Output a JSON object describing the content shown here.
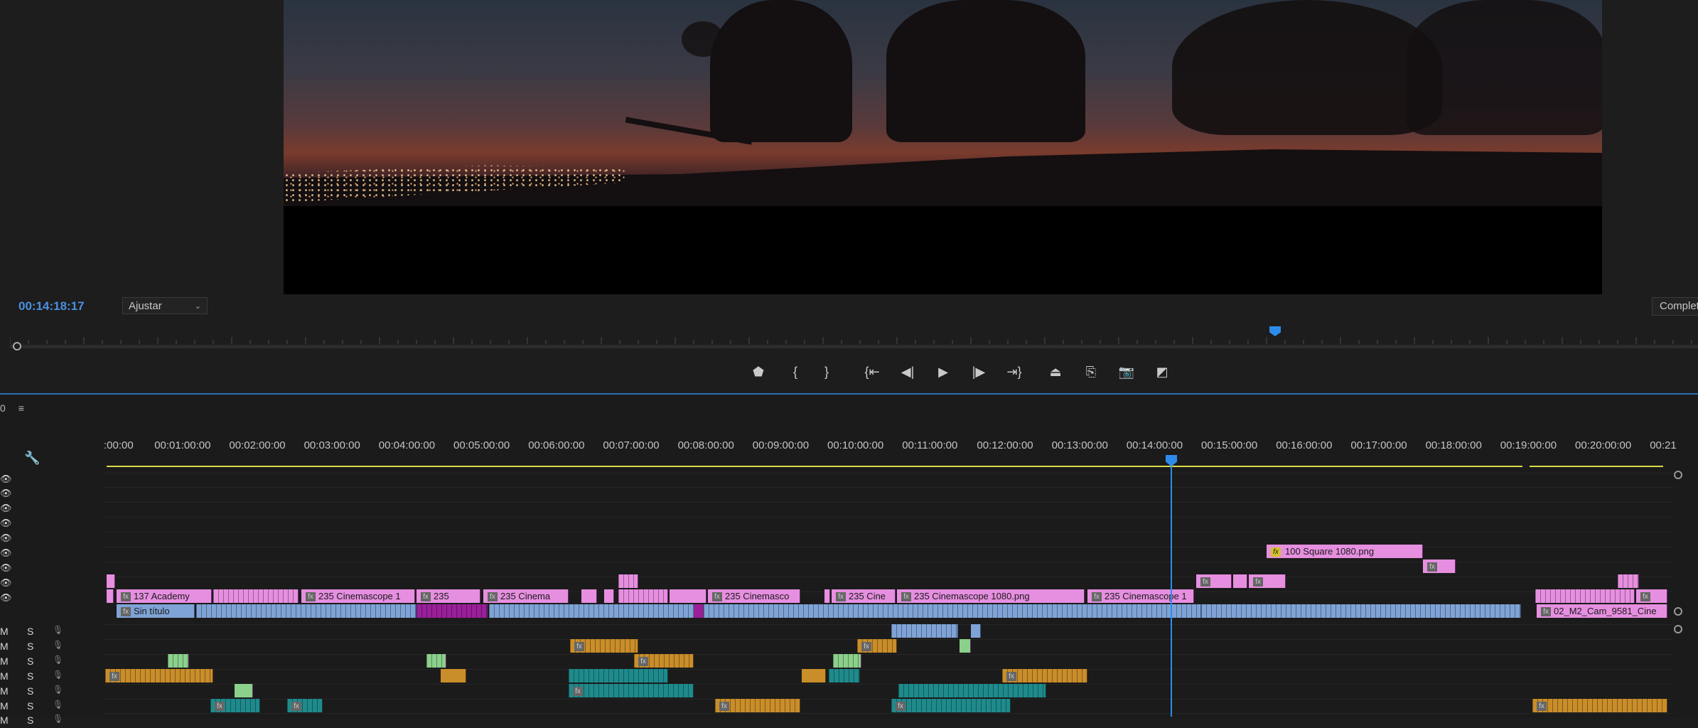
{
  "monitor": {
    "timecode": "00:14:18:17",
    "fit_label": "Ajustar",
    "quality_label": "Completa",
    "transport": [
      {
        "name": "add-marker-button",
        "glyph": "⬟"
      },
      {
        "name": "mark-in-button",
        "glyph": "{"
      },
      {
        "name": "mark-out-button",
        "glyph": "}"
      },
      {
        "name": "go-to-in-button",
        "glyph": "{⇤"
      },
      {
        "name": "step-back-button",
        "glyph": "◀|"
      },
      {
        "name": "play-button",
        "glyph": "▶"
      },
      {
        "name": "step-forward-button",
        "glyph": "|▶"
      },
      {
        "name": "go-to-out-button",
        "glyph": "⇥}"
      },
      {
        "name": "lift-button",
        "glyph": "⏏"
      },
      {
        "name": "extract-button",
        "glyph": "⎘"
      },
      {
        "name": "export-frame-button",
        "glyph": "📷"
      },
      {
        "name": "comparison-view-button",
        "glyph": "◩"
      }
    ]
  },
  "timeline": {
    "panel_suffix": "0",
    "menu_glyph": "≡",
    "ruler_labels": [
      ":00:00",
      "00:01:00:00",
      "00:02:00:00",
      "00:03:00:00",
      "00:04:00:00",
      "00:05:00:00",
      "00:06:00:00",
      "00:07:00:00",
      "00:08:00:00",
      "00:09:00:00",
      "00:10:00:00",
      "00:11:00:00",
      "00:12:00:00",
      "00:13:00:00",
      "00:14:00:00",
      "00:15:00:00",
      "00:16:00:00",
      "00:17:00:00",
      "00:18:00:00",
      "00:19:00:00",
      "00:20:00:00",
      "00:21"
    ],
    "audio_header": {
      "mute": "M",
      "solo": "S"
    },
    "clips": {
      "square": "100 Square 1080.png",
      "academy": "137 Academy",
      "cinema1": "235 Cinemascope 1",
      "cinema_short": "235",
      "cinema_a": "235 Cinema",
      "cinema_b": "235 Cinemasco",
      "cinema_c": "235 Cine",
      "cinema_full": "235 Cinemascope 1080.png",
      "cinema_d": "235 Cinemascope 1",
      "sin_titulo": "Sin título",
      "cam": "02_M2_Cam_9581_Cine"
    },
    "colors": {
      "clip_video": "#e68fe0",
      "clip_adjust": "#7fa3d6",
      "clip_audio_orange": "#c98d2a",
      "clip_audio_teal": "#1f8a8c",
      "playhead": "#2d8ceb"
    }
  }
}
